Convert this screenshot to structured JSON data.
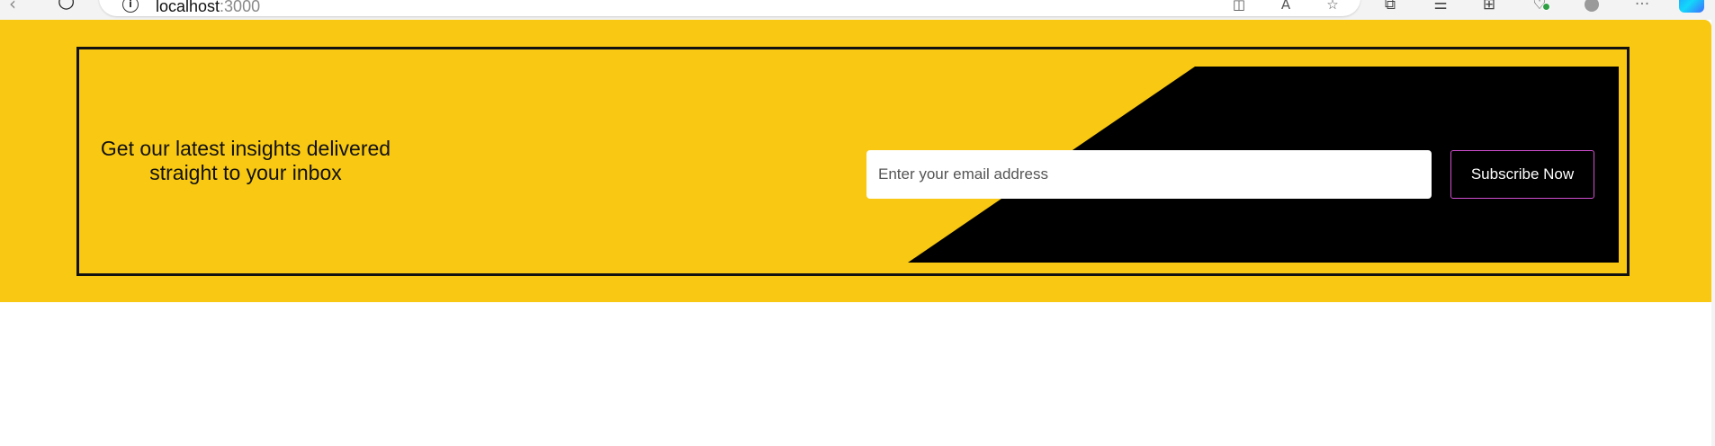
{
  "browser": {
    "url_host": "localhost",
    "url_port": ":3000",
    "icons": {
      "back": "back-arrow-icon",
      "refresh": "refresh-icon",
      "site_info": "info-icon",
      "split_screen": "split-screen-icon",
      "read_aloud": "read-aloud-icon",
      "favorite": "star-icon",
      "split_window": "split-window-icon",
      "favorites": "favorites-list-icon",
      "collections": "collections-icon",
      "browser_essentials": "heart-shield-icon",
      "profile": "profile-icon",
      "more": "more-icon",
      "copilot": "copilot-icon"
    }
  },
  "newsletter": {
    "headline": "Get our latest insights delivered straight to your inbox",
    "email_placeholder": "Enter your email address",
    "subscribe_label": "Subscribe Now",
    "colors": {
      "banner_bg": "#f8c812",
      "box_border": "#111111",
      "shape": "#000000",
      "button_bg": "#000000",
      "button_border": "#d24fd1",
      "button_text": "#ffffff"
    }
  }
}
